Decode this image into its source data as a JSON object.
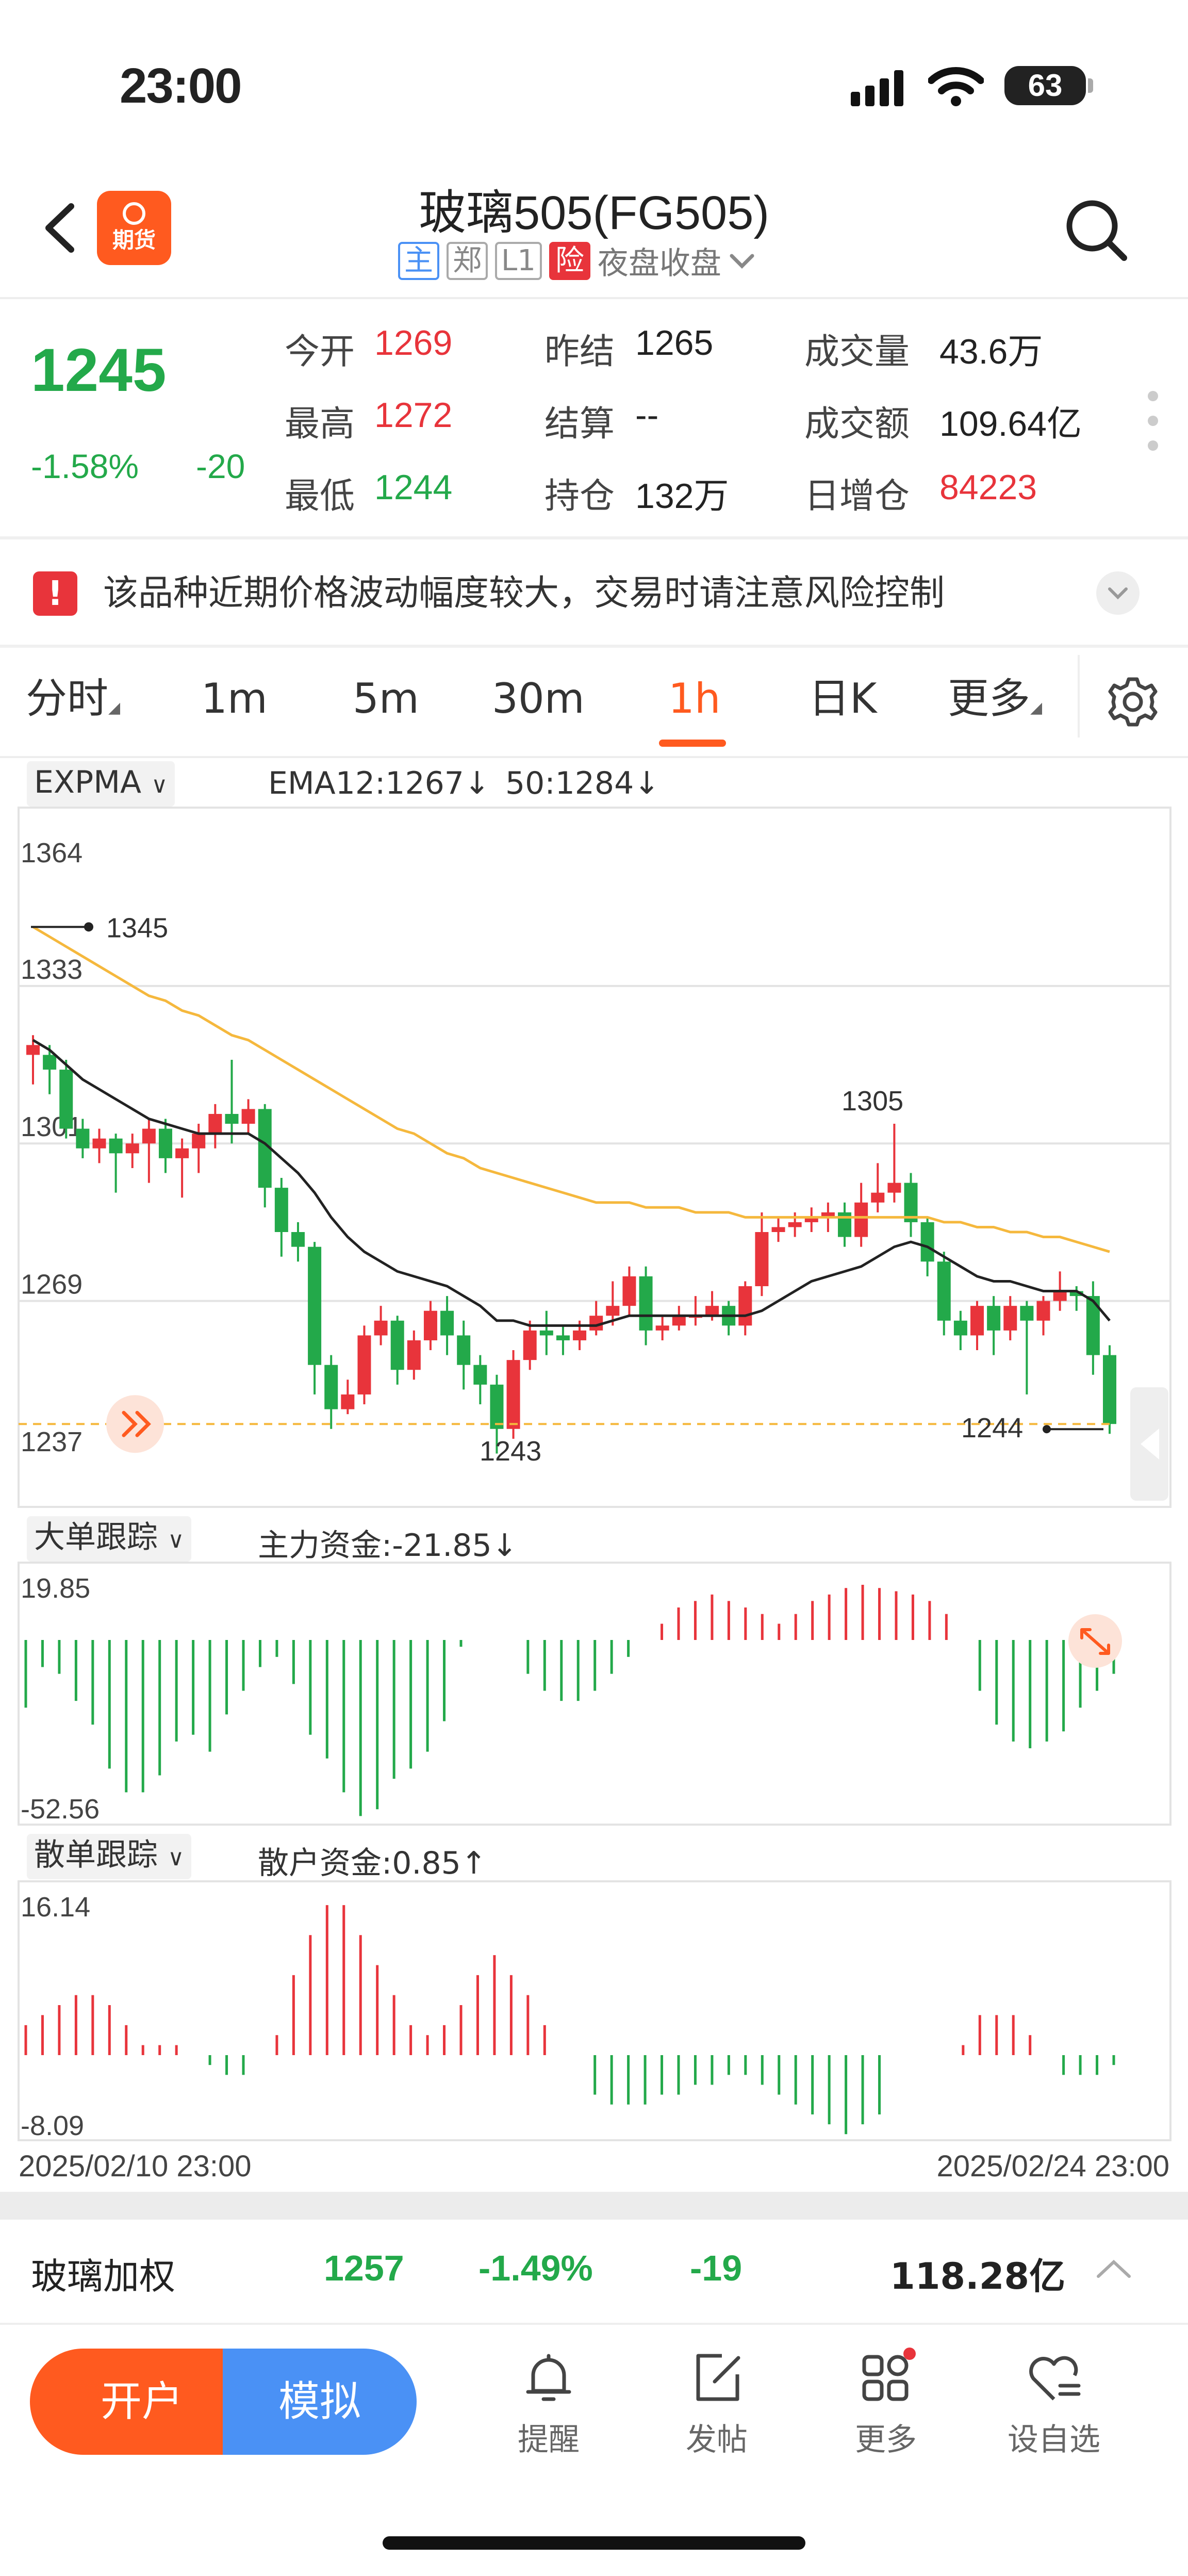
{
  "status": {
    "time": "23:00",
    "battery": "63"
  },
  "header": {
    "title": "玻璃505(FG505)",
    "tags": [
      "主",
      "郑",
      "L1",
      "险"
    ],
    "session": "夜盘收盘"
  },
  "quote": {
    "price": "1245",
    "change_pct": "-1.58%",
    "change": "-20",
    "fields": {
      "open_label": "今开",
      "open": "1269",
      "prev_settle_label": "昨结",
      "prev_settle": "1265",
      "volume_label": "成交量",
      "volume": "43.6万",
      "high_label": "最高",
      "high": "1272",
      "settle_label": "结算",
      "settle": "--",
      "turnover_label": "成交额",
      "turnover": "109.64亿",
      "low_label": "最低",
      "low": "1244",
      "oi_label": "持仓",
      "oi": "132万",
      "oi_change_label": "日增仓",
      "oi_change": "84223"
    }
  },
  "notice": {
    "text": "该品种近期价格波动幅度较大，交易时请注意风险控制"
  },
  "tabs": [
    "分时",
    "1m",
    "5m",
    "30m",
    "1h",
    "日K",
    "更多"
  ],
  "active_tab": "1h",
  "indicators": {
    "main_selector": "EXPMA",
    "ema12": "EMA12:1267↓",
    "ema50": "50:1284↓",
    "big_selector": "大单跟踪",
    "big_value": "主力资金:-21.85↓",
    "retail_selector": "散单跟踪",
    "retail_value": "散户资金:0.85↑",
    "start_date": "2025/02/10 23:00",
    "end_date": "2025/02/24 23:00"
  },
  "colors": {
    "up": "#e8343b",
    "down": "#23a94a",
    "ema12": "#222222",
    "ema50": "#f5b83d",
    "accent": "#ff5a1f",
    "sim": "#4a91f5"
  },
  "chart_data": [
    {
      "type": "candlestick",
      "ylim": [
        1237,
        1364
      ],
      "y_ticks": [
        "1364",
        "1333",
        "1301",
        "1269",
        "1237"
      ],
      "annotations": {
        "high": "1345",
        "peak": "1305",
        "low": "1243",
        "last": "1244"
      },
      "candles": [
        [
          1319,
          1321,
          1313,
          1323
        ],
        [
          1319,
          1316,
          1311,
          1321
        ],
        [
          1316,
          1304,
          1302,
          1318
        ],
        [
          1304,
          1300,
          1298,
          1306
        ],
        [
          1300,
          1302,
          1297,
          1304
        ],
        [
          1302,
          1299,
          1291,
          1303
        ],
        [
          1299,
          1301,
          1296,
          1303
        ],
        [
          1301,
          1304,
          1293,
          1306
        ],
        [
          1304,
          1298,
          1295,
          1306
        ],
        [
          1298,
          1300,
          1290,
          1302
        ],
        [
          1300,
          1303,
          1295,
          1305
        ],
        [
          1303,
          1307,
          1300,
          1309
        ],
        [
          1307,
          1305,
          1301,
          1318
        ],
        [
          1305,
          1308,
          1303,
          1310
        ],
        [
          1308,
          1292,
          1288,
          1309
        ],
        [
          1292,
          1283,
          1278,
          1294
        ],
        [
          1283,
          1280,
          1277,
          1285
        ],
        [
          1280,
          1256,
          1250,
          1281
        ],
        [
          1256,
          1247,
          1243,
          1258
        ],
        [
          1247,
          1250,
          1246,
          1253
        ],
        [
          1250,
          1262,
          1248,
          1264
        ],
        [
          1262,
          1265,
          1260,
          1268
        ],
        [
          1265,
          1255,
          1252,
          1266
        ],
        [
          1255,
          1261,
          1253,
          1263
        ],
        [
          1261,
          1267,
          1259,
          1269
        ],
        [
          1267,
          1262,
          1258,
          1270
        ],
        [
          1262,
          1256,
          1251,
          1265
        ],
        [
          1256,
          1252,
          1248,
          1258
        ],
        [
          1252,
          1243,
          1238,
          1254
        ],
        [
          1243,
          1257,
          1241,
          1259
        ],
        [
          1257,
          1263,
          1255,
          1265
        ],
        [
          1263,
          1262,
          1258,
          1267
        ],
        [
          1262,
          1261,
          1258,
          1264
        ],
        [
          1261,
          1263,
          1259,
          1265
        ],
        [
          1263,
          1266,
          1262,
          1269
        ],
        [
          1266,
          1268,
          1264,
          1273
        ],
        [
          1268,
          1274,
          1266,
          1276
        ],
        [
          1274,
          1263,
          1260,
          1276
        ],
        [
          1263,
          1264,
          1261,
          1266
        ],
        [
          1264,
          1266,
          1263,
          1268
        ],
        [
          1266,
          1266,
          1264,
          1270
        ],
        [
          1266,
          1268,
          1265,
          1271
        ],
        [
          1268,
          1264,
          1262,
          1269
        ],
        [
          1264,
          1272,
          1262,
          1273
        ],
        [
          1272,
          1283,
          1270,
          1287
        ],
        [
          1283,
          1284,
          1281,
          1286
        ],
        [
          1284,
          1285,
          1282,
          1287
        ],
        [
          1285,
          1286,
          1283,
          1288
        ],
        [
          1286,
          1287,
          1283,
          1289
        ],
        [
          1287,
          1282,
          1280,
          1289
        ],
        [
          1282,
          1289,
          1280,
          1293
        ],
        [
          1289,
          1291,
          1287,
          1297
        ],
        [
          1291,
          1293,
          1289,
          1305
        ],
        [
          1293,
          1285,
          1282,
          1295
        ],
        [
          1285,
          1277,
          1274,
          1286
        ],
        [
          1277,
          1265,
          1262,
          1279
        ],
        [
          1265,
          1262,
          1259,
          1267
        ],
        [
          1262,
          1268,
          1259,
          1269
        ],
        [
          1268,
          1263,
          1258,
          1270
        ],
        [
          1263,
          1268,
          1261,
          1270
        ],
        [
          1268,
          1265,
          1250,
          1269
        ],
        [
          1265,
          1269,
          1262,
          1270
        ],
        [
          1269,
          1271,
          1267,
          1275
        ],
        [
          1271,
          1270,
          1267,
          1272
        ],
        [
          1270,
          1258,
          1254,
          1273
        ],
        [
          1258,
          1244,
          1242,
          1260
        ]
      ],
      "ema12": [
        1322,
        1320,
        1317,
        1314,
        1312,
        1310,
        1308,
        1306,
        1305,
        1304,
        1303,
        1303,
        1303,
        1303,
        1301,
        1298,
        1295,
        1291,
        1286,
        1282,
        1279,
        1277,
        1275,
        1274,
        1273,
        1272,
        1270,
        1268,
        1265,
        1265,
        1264,
        1264,
        1264,
        1264,
        1264,
        1265,
        1266,
        1266,
        1266,
        1266,
        1266,
        1266,
        1266,
        1266,
        1267,
        1269,
        1271,
        1273,
        1274,
        1275,
        1276,
        1278,
        1280,
        1281,
        1280,
        1278,
        1276,
        1274,
        1273,
        1273,
        1272,
        1271,
        1271,
        1271,
        1269,
        1265
      ],
      "ema50": [
        1345,
        1343,
        1341,
        1339,
        1337,
        1335,
        1333,
        1331,
        1330,
        1328,
        1327,
        1325,
        1323,
        1322,
        1320,
        1318,
        1316,
        1314,
        1312,
        1310,
        1308,
        1306,
        1304,
        1303,
        1301,
        1299,
        1298,
        1296,
        1295,
        1294,
        1293,
        1292,
        1291,
        1290,
        1289,
        1289,
        1289,
        1288,
        1288,
        1288,
        1287,
        1287,
        1287,
        1286,
        1286,
        1286,
        1286,
        1286,
        1286,
        1286,
        1286,
        1286,
        1286,
        1286,
        1286,
        1285,
        1285,
        1284,
        1284,
        1283,
        1283,
        1282,
        1282,
        1281,
        1280,
        1279
      ]
    },
    {
      "type": "bar",
      "name": "大单跟踪",
      "ylim": [
        -52.56,
        19.85
      ],
      "y_ticks": [
        "19.85",
        "-52.56"
      ],
      "values": [
        -20,
        -8,
        -10,
        -18,
        -25,
        -38,
        -45,
        -45,
        -40,
        -30,
        -28,
        -33,
        -22,
        -15,
        -8,
        -5,
        -13,
        -28,
        -35,
        -45,
        -52,
        -50,
        -41,
        -38,
        -33,
        -24,
        -2,
        0,
        0,
        0,
        -10,
        -15,
        -18,
        -18,
        -15,
        -10,
        -5,
        0,
        5,
        10,
        12,
        14,
        12,
        10,
        8,
        5,
        8,
        12,
        14,
        16,
        17,
        16,
        15,
        14,
        12,
        8,
        0,
        -15,
        -25,
        -30,
        -32,
        -30,
        -27,
        -20,
        -15,
        -10
      ]
    },
    {
      "type": "bar",
      "name": "散单跟踪",
      "ylim": [
        -8.09,
        16.14
      ],
      "y_ticks": [
        "16.14",
        "-8.09"
      ],
      "values": [
        3,
        4,
        5,
        6,
        6,
        5,
        3,
        1,
        1,
        1,
        0,
        -1,
        -2,
        -2,
        0,
        2,
        8,
        12,
        15,
        15,
        12,
        9,
        6,
        3,
        2,
        3,
        5,
        8,
        10,
        8,
        6,
        3,
        0,
        0,
        -4,
        -5,
        -5,
        -5,
        -4,
        -4,
        -3,
        -3,
        -2,
        -2,
        -3,
        -4,
        -5,
        -6,
        -7,
        -8,
        -7,
        -6,
        0,
        0,
        0,
        0,
        1,
        4,
        4,
        4,
        2,
        0,
        -2,
        -2,
        -2,
        -1
      ]
    }
  ],
  "bottom": {
    "name": "玻璃加权",
    "price": "1257",
    "pct": "-1.49%",
    "chg": "-19",
    "turnover": "118.28亿",
    "open_account": "开户",
    "simulate": "模拟",
    "nav": [
      "提醒",
      "发帖",
      "更多",
      "设自选"
    ]
  }
}
